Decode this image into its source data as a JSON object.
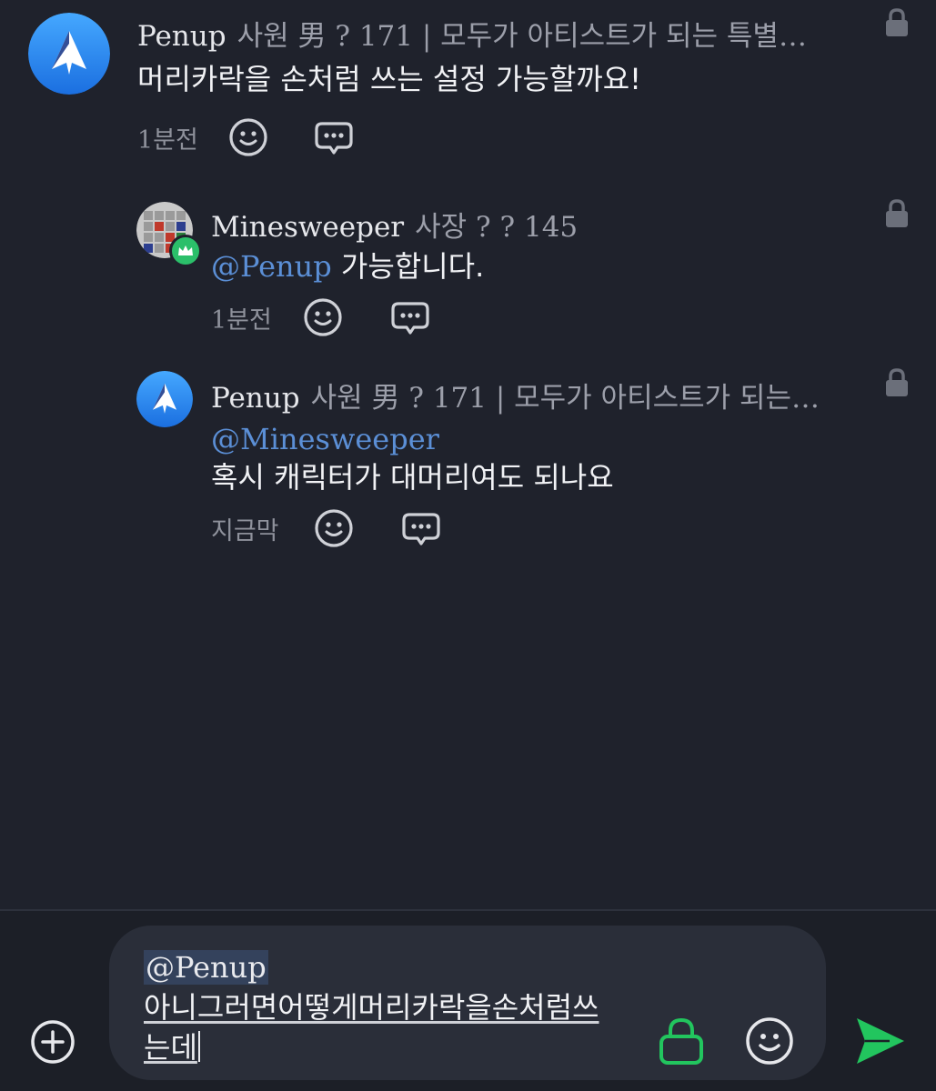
{
  "comments": [
    {
      "nick": "Penup",
      "info": "사원 男 ? 171 | 모두가 아티스트가 되는 특별…",
      "text": "머리카락을 손처럼 쓰는 설정 가능할까요!",
      "time": "1분전"
    },
    {
      "nick": "Minesweeper",
      "info": "사장 ? ? 145",
      "mention": "@Penup",
      "text": "가능합니다.",
      "time": "1분전"
    },
    {
      "nick": "Penup",
      "info": "사원 男 ? 171 | 모두가 아티스트가 되는…",
      "mention": "@Minesweeper",
      "text": "혹시 캐릭터가 대머리여도 되나요",
      "time": "지금막"
    }
  ],
  "composer": {
    "mention": "@Penup",
    "line1": "아니그러면어떻게머리카락을손처럼쓰",
    "line2": "는데"
  },
  "colors": {
    "background": "#1f222c",
    "mention": "#5b8fd6",
    "send": "#22c55e",
    "lock_active": "#22c55e",
    "avatar_blue": "#2f8df6"
  },
  "icons": [
    "penup-logo",
    "minesweeper-avatar",
    "crown-badge",
    "emoji-icon",
    "reply-icon",
    "lock-icon",
    "plus-circle-icon",
    "send-icon"
  ]
}
